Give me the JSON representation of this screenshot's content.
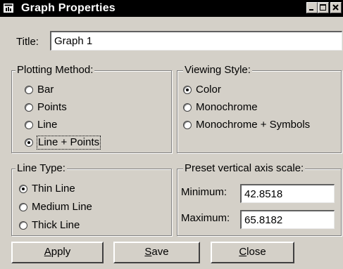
{
  "window": {
    "title": "Graph Properties",
    "icons": [
      "app-icon",
      "minimize-icon",
      "maximize-icon",
      "close-icon"
    ]
  },
  "title_field": {
    "label": "Title:",
    "value": "Graph 1"
  },
  "plotting_method": {
    "label": "Plotting Method:",
    "options": [
      "Bar",
      "Points",
      "Line",
      "Line + Points"
    ],
    "selected": "Line + Points"
  },
  "viewing_style": {
    "label": "Viewing Style:",
    "options": [
      "Color",
      "Monochrome",
      "Monochrome + Symbols"
    ],
    "selected": "Color"
  },
  "line_type": {
    "label": "Line Type:",
    "options": [
      "Thin Line",
      "Medium Line",
      "Thick Line"
    ],
    "selected": "Thin Line"
  },
  "axis_scale": {
    "label": "Preset vertical axis scale:",
    "min_label": "Minimum:",
    "min_value": "42.8518",
    "max_label": "Maximum:",
    "max_value": "65.8182"
  },
  "buttons": {
    "apply": {
      "pre": "",
      "key": "A",
      "post": "pply"
    },
    "save": {
      "pre": "",
      "key": "S",
      "post": "ave"
    },
    "close": {
      "pre": "",
      "key": "C",
      "post": "lose"
    }
  }
}
